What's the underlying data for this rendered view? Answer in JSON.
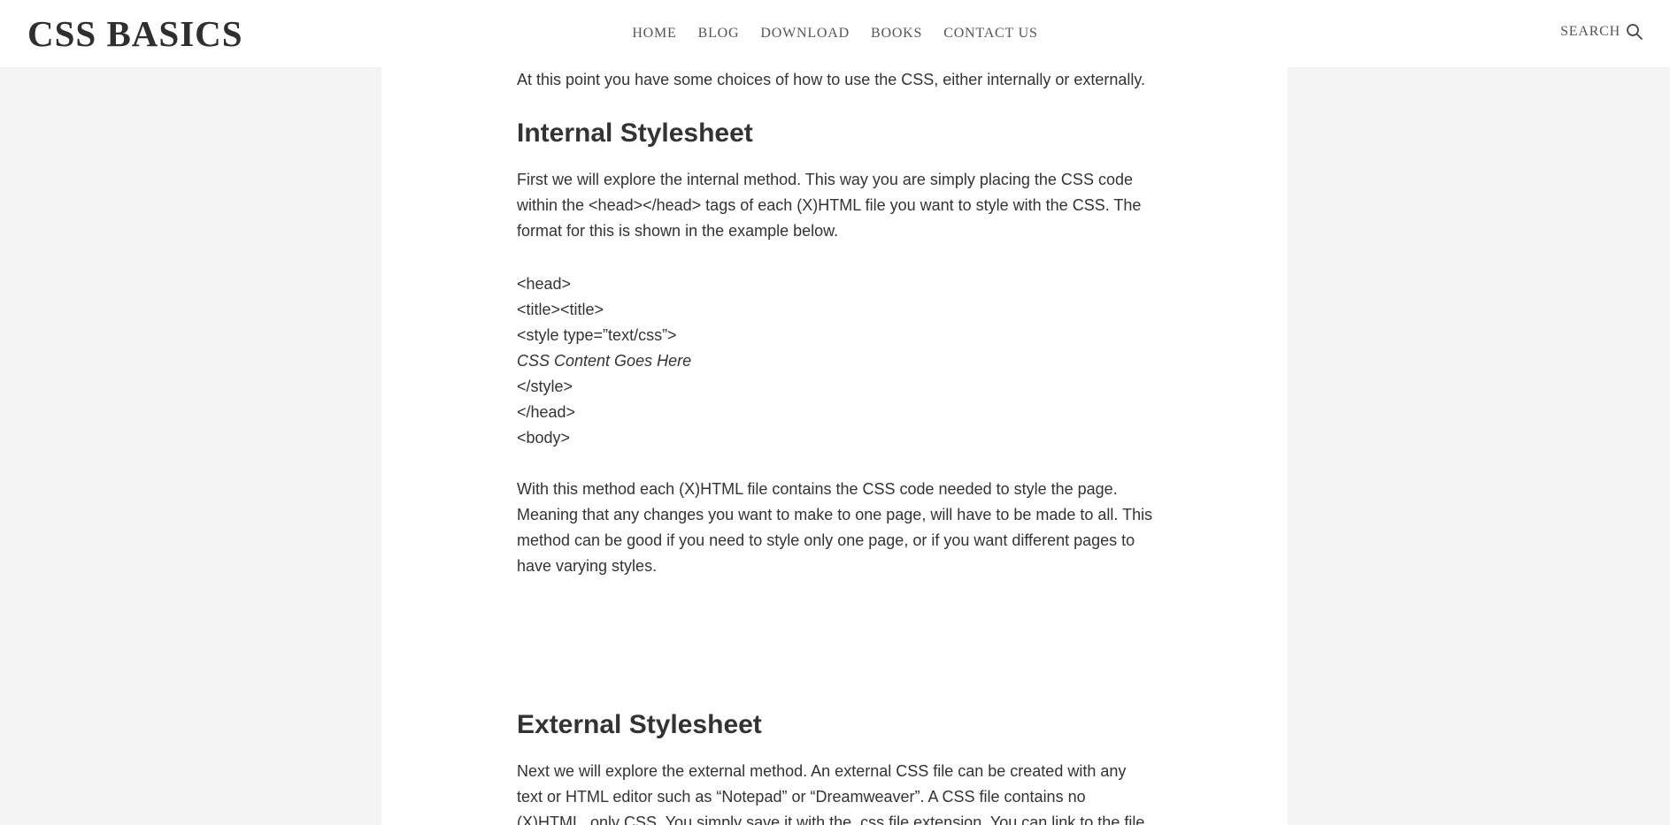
{
  "header": {
    "logo": "CSS BASICS",
    "nav": [
      {
        "label": "HOME"
      },
      {
        "label": "BLOG"
      },
      {
        "label": "DOWNLOAD"
      },
      {
        "label": "BOOKS"
      },
      {
        "label": "CONTACT US"
      }
    ],
    "search_label": "SEARCH",
    "search_icon": "search-icon"
  },
  "article": {
    "intro": "At this point you have some choices of how to use the CSS, either internally or externally.",
    "internal_heading": "Internal Stylesheet",
    "internal_p1": "First we will explore the internal method. This way you are simply placing the CSS code within the <head></head> tags of each (X)HTML file you want to style with the CSS. The format for this is shown in the example below.",
    "code": [
      "<head>",
      "<title><title>",
      "<style type=”text/css”>",
      "CSS Content Goes Here",
      "</style>",
      "</head>",
      "<body>"
    ],
    "internal_p2": "With this method each (X)HTML file contains the CSS code needed to style the page. Meaning that any changes you want to make to one page, will have to be made to all. This method can be good if you need to style only one page, or if you want different pages to have varying styles.",
    "external_heading": "External Stylesheet",
    "external_p1": "Next we will explore the external method. An external CSS file can be created with any text or HTML editor such as “Notepad” or “Dreamweaver”. A CSS file contains no (X)HTML, only CSS. You simply save it with the .css file extension. You can link to the file externally by"
  }
}
